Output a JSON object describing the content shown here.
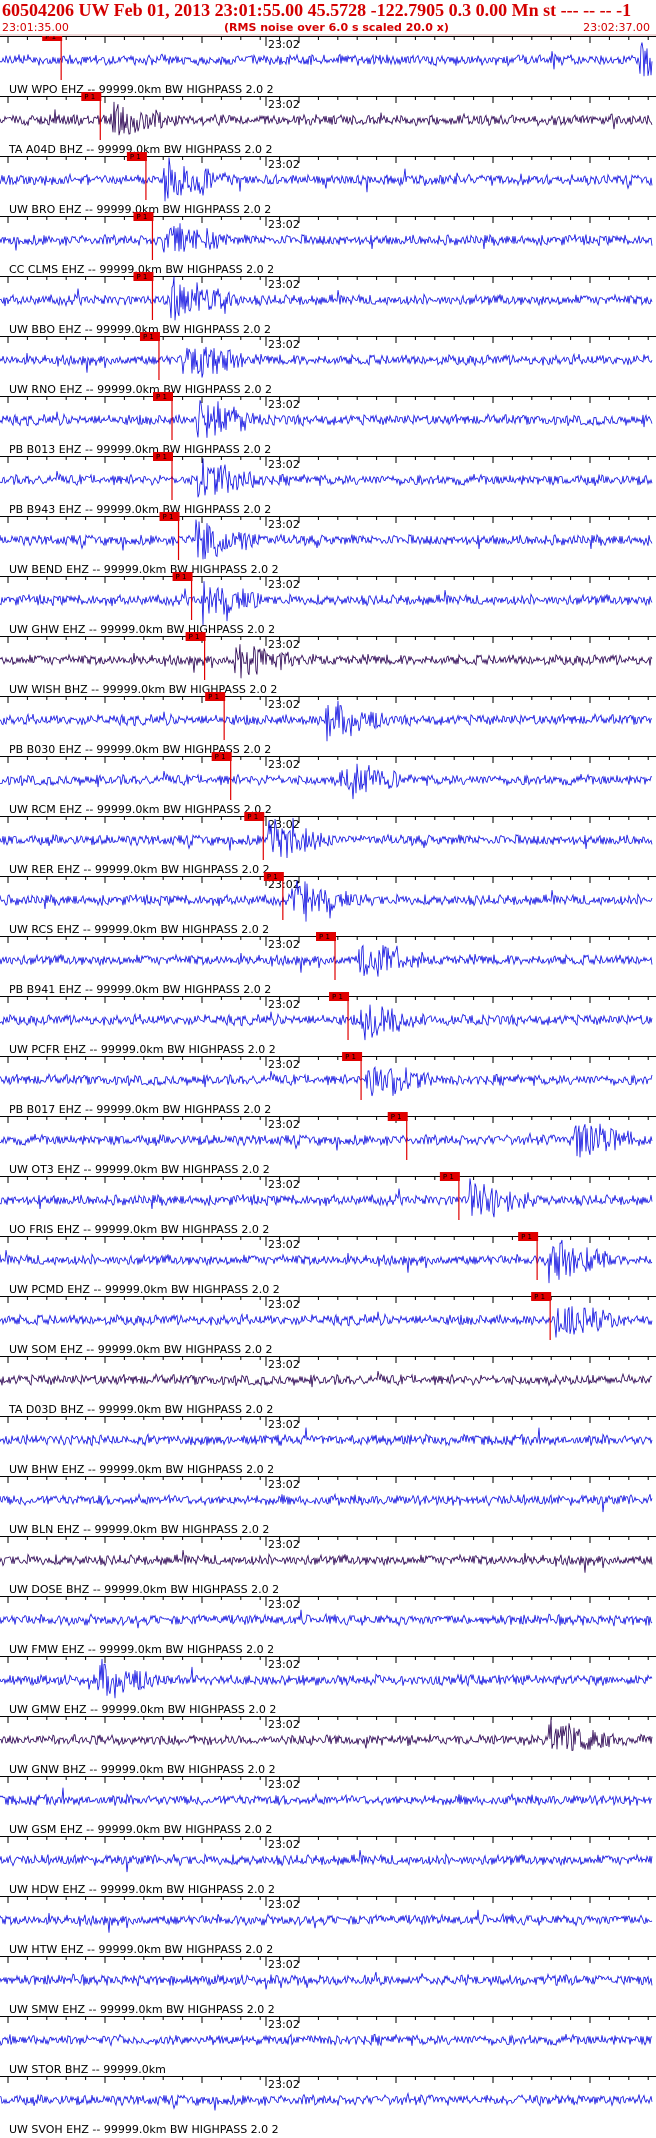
{
  "header": {
    "title": "60504206 UW Feb 01, 2013 23:01:55.00   45.5728 -122.7905  0.3 0.00 Mn st --- -- --   -1",
    "start_time": "23:01:35.00",
    "subtitle": "(RMS noise over 6.0 s scaled 20.0 x)",
    "end_time": "23:02:37.00"
  },
  "minute_label": "23:02",
  "pick_label": "P 1",
  "colors": {
    "trace": "#1010e0",
    "trace_dark": "#280050",
    "pick": "#e00000",
    "text": "#000000",
    "header": "#d40000"
  },
  "traces": [
    {
      "label": "UW WPO EHZ -- 99999.0km BW  HIGHPASS  2.0  2",
      "pick": 0.08,
      "burst": 0.98,
      "dark": false
    },
    {
      "label": "TA A04D BHZ -- 99999.0km BW  HIGHPASS  2.0  2",
      "pick": 0.14,
      "burst": 0.17,
      "dark": true
    },
    {
      "label": "UW BRO EHZ -- 99999.0km BW  HIGHPASS  2.0  2",
      "pick": 0.21,
      "burst": 0.25,
      "dark": false
    },
    {
      "label": "CC CLMS EHZ -- 99999.0km BW  HIGHPASS  2.0  2",
      "pick": 0.22,
      "burst": 0.25,
      "dark": false
    },
    {
      "label": "UW BBO EHZ -- 99999.0km BW  HIGHPASS  2.0  2",
      "pick": 0.22,
      "burst": 0.26,
      "dark": false
    },
    {
      "label": "UW RNO EHZ -- 99999.0km BW  HIGHPASS  2.0  2",
      "pick": 0.23,
      "burst": 0.28,
      "dark": false
    },
    {
      "label": "PB B013 EHZ -- 99999.0km BW  HIGHPASS  2.0  2",
      "pick": 0.25,
      "burst": 0.3,
      "dark": false
    },
    {
      "label": "PB B943 EHZ -- 99999.0km BW  HIGHPASS  2.0  2",
      "pick": 0.25,
      "burst": 0.3,
      "dark": false
    },
    {
      "label": "UW BEND EHZ -- 99999.0km BW  HIGHPASS  2.0  2",
      "pick": 0.26,
      "burst": 0.3,
      "dark": false
    },
    {
      "label": "UW GHW EHZ -- 99999.0km BW  HIGHPASS  2.0  2",
      "pick": 0.28,
      "burst": 0.31,
      "dark": false
    },
    {
      "label": "UW WISH BHZ -- 99999.0km BW  HIGHPASS  2.0  2",
      "pick": 0.3,
      "burst": 0.36,
      "dark": true
    },
    {
      "label": "PB B030 EHZ -- 99999.0km BW  HIGHPASS  2.0  2",
      "pick": 0.33,
      "burst": 0.5,
      "dark": false
    },
    {
      "label": "UW RCM EHZ -- 99999.0km BW  HIGHPASS  2.0  2",
      "pick": 0.34,
      "burst": 0.52,
      "dark": false
    },
    {
      "label": "UW RER EHZ -- 99999.0km BW  HIGHPASS  2.0  2",
      "pick": 0.39,
      "burst": 0.41,
      "dark": false
    },
    {
      "label": "UW RCS EHZ -- 99999.0km BW  HIGHPASS  2.0  2",
      "pick": 0.42,
      "burst": 0.45,
      "dark": false
    },
    {
      "label": "PB B941 EHZ -- 99999.0km BW  HIGHPASS  2.0  2",
      "pick": 0.5,
      "burst": 0.55,
      "dark": false
    },
    {
      "label": "UW PCFR EHZ -- 99999.0km BW  HIGHPASS  2.0  2",
      "pick": 0.52,
      "burst": 0.55,
      "dark": false
    },
    {
      "label": "PB B017 EHZ -- 99999.0km BW  HIGHPASS  2.0  2",
      "pick": 0.54,
      "burst": 0.56,
      "dark": false
    },
    {
      "label": "UW OT3 EHZ -- 99999.0km BW  HIGHPASS  2.0  2",
      "pick": 0.61,
      "burst": 0.88,
      "dark": false
    },
    {
      "label": "UO FRIS EHZ -- 99999.0km BW  HIGHPASS  2.0  2",
      "pick": 0.69,
      "burst": 0.72,
      "dark": false
    },
    {
      "label": "UW PCMD EHZ -- 99999.0km BW  HIGHPASS  2.0  2",
      "pick": 0.81,
      "burst": 0.84,
      "dark": false
    },
    {
      "label": "UW SOM EHZ -- 99999.0km BW  HIGHPASS  2.0  2",
      "pick": 0.83,
      "burst": 0.85,
      "dark": false
    },
    {
      "label": "TA D03D BHZ -- 99999.0km BW  HIGHPASS  2.0  2",
      "pick": null,
      "burst": null,
      "dark": true
    },
    {
      "label": "UW BHW EHZ -- 99999.0km BW  HIGHPASS  2.0  2",
      "pick": null,
      "burst": null,
      "dark": false
    },
    {
      "label": "UW BLN EHZ -- 99999.0km BW  HIGHPASS  2.0  2",
      "pick": null,
      "burst": null,
      "dark": false
    },
    {
      "label": "UW DOSE BHZ -- 99999.0km BW  HIGHPASS  2.0  2",
      "pick": null,
      "burst": null,
      "dark": true
    },
    {
      "label": "UW FMW EHZ -- 99999.0km BW  HIGHPASS  2.0  2",
      "pick": null,
      "burst": null,
      "dark": false
    },
    {
      "label": "UW GMW EHZ -- 99999.0km BW  HIGHPASS  2.0  2",
      "pick": null,
      "burst": 0.15,
      "dark": false
    },
    {
      "label": "UW GNW BHZ -- 99999.0km BW  HIGHPASS  2.0  2",
      "pick": null,
      "burst": 0.84,
      "dark": true
    },
    {
      "label": "UW GSM EHZ -- 99999.0km BW  HIGHPASS  2.0  2",
      "pick": null,
      "burst": null,
      "dark": false
    },
    {
      "label": "UW HDW EHZ -- 99999.0km BW  HIGHPASS  2.0  2",
      "pick": null,
      "burst": null,
      "dark": false
    },
    {
      "label": "UW HTW EHZ -- 99999.0km BW  HIGHPASS  2.0  2",
      "pick": null,
      "burst": null,
      "dark": false
    },
    {
      "label": "UW SMW EHZ -- 99999.0km BW  HIGHPASS  2.0  2",
      "pick": null,
      "burst": null,
      "dark": false
    },
    {
      "label": "UW STOR BHZ -- 99999.0km",
      "pick": null,
      "burst": null,
      "dark": false
    },
    {
      "label": "UW SVOH EHZ -- 99999.0km BW  HIGHPASS  2.0  2",
      "pick": null,
      "burst": null,
      "dark": false
    }
  ]
}
